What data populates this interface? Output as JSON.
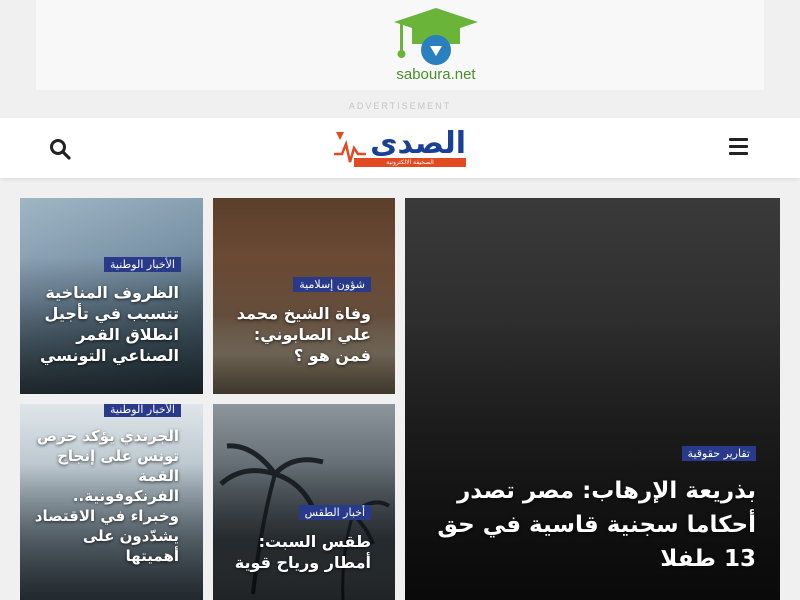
{
  "ad": {
    "brand": "saboura.net",
    "label": "ADVERTISEMENT"
  },
  "header": {
    "logo_text": "الصدى",
    "logo_tagline": "الصحيفة الالكترونية",
    "brand_colors": {
      "primary": "#1a3f96",
      "accent": "#e24a22"
    },
    "icons": {
      "search": "search-icon",
      "menu": "hamburger-menu-icon"
    }
  },
  "cards": [
    {
      "category": "الأخبار الوطنية",
      "title": "الظروف المناخية تتسبب في تأجيل انطلاق القمر الصناعي التونسي"
    },
    {
      "category": "شؤون إسلامية",
      "title": "وفاة الشيخ محمد علي الصابوني: فمن هو ؟"
    },
    {
      "category": "الأخبار الوطنية",
      "title": "الجرندي يؤكد حرص تونس على إنجاح القمة الفرنكوفونية.. وخبراء في الاقتصاد يشدّدون على أهميتها"
    },
    {
      "category": "أخبار الطقس",
      "title": "طقس السبت: أمطار ورياح قوية"
    },
    {
      "category": "تقارير حقوقية",
      "title": "بذريعة الإرهاب: مصر تصدر أحكاما سجنية قاسية في حق 13 طفلا"
    }
  ],
  "colors": {
    "category_badge": "#2a3a8a"
  }
}
